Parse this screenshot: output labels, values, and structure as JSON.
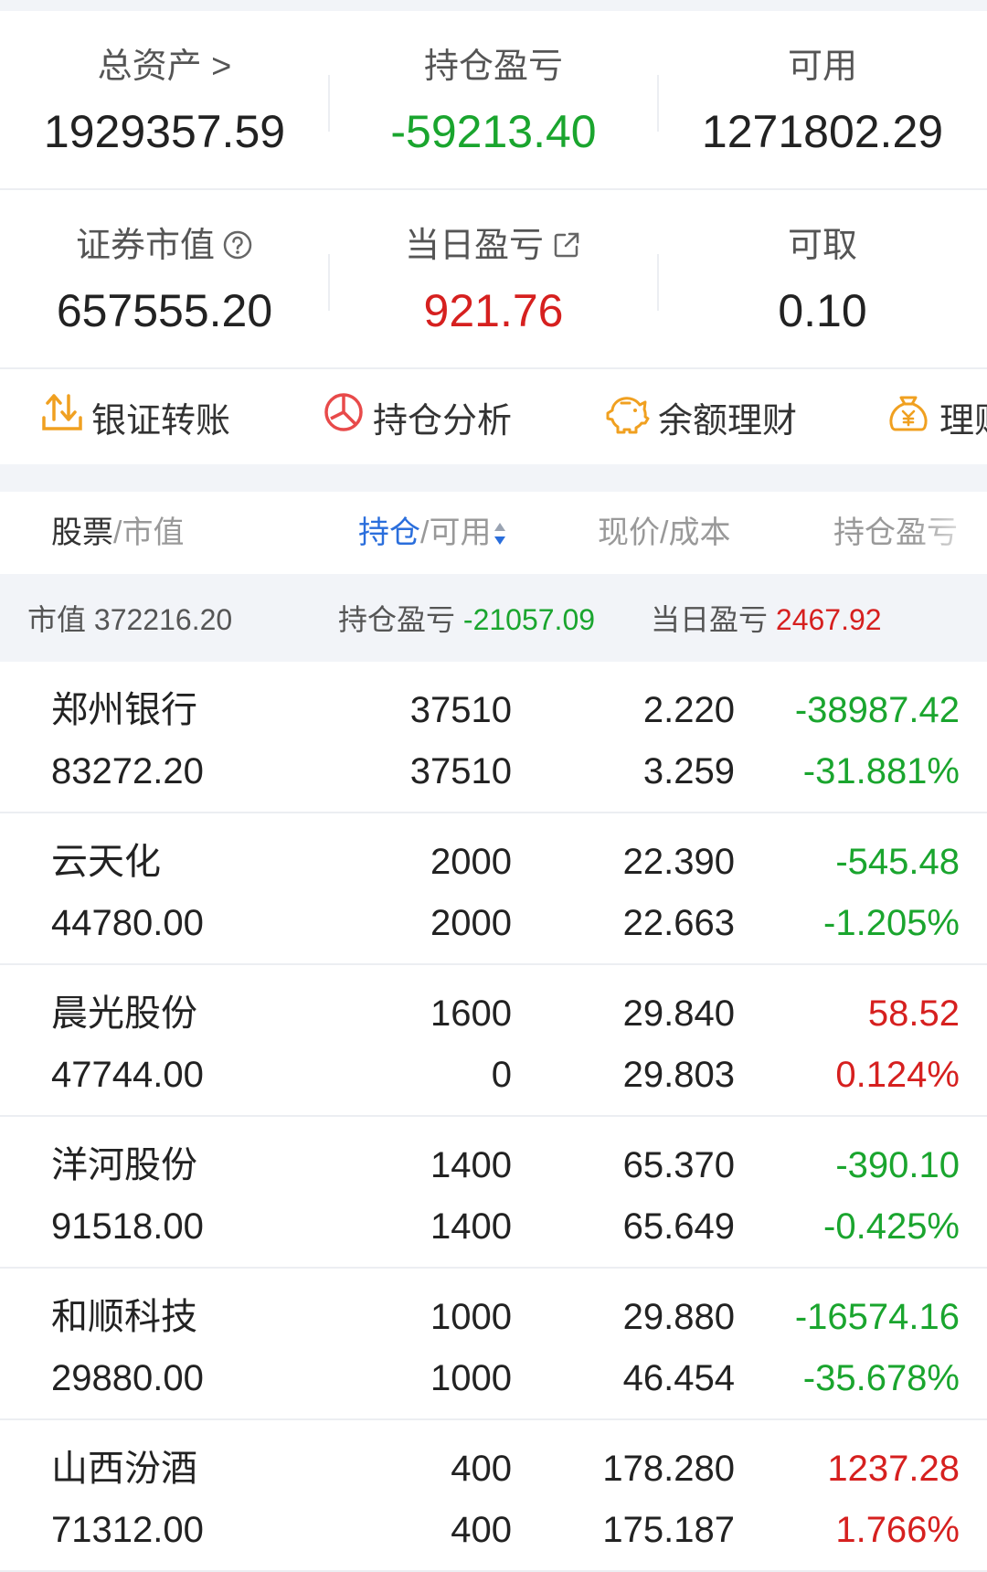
{
  "summary": {
    "total_assets_label": "总资产 >",
    "total_assets": "1929357.59",
    "holding_pl_label": "持仓盈亏",
    "holding_pl": "-59213.40",
    "available_label": "可用",
    "available": "1271802.29",
    "market_value_label": "证券市值",
    "market_value": "657555.20",
    "daily_pl_label": "当日盈亏",
    "daily_pl": "921.76",
    "withdrawable_label": "可取",
    "withdrawable": "0.10"
  },
  "actions": [
    {
      "label": "银证转账",
      "icon": "transfer-icon"
    },
    {
      "label": "持仓分析",
      "icon": "pie-chart-icon"
    },
    {
      "label": "余额理财",
      "icon": "piggy-bank-icon"
    },
    {
      "label": "理财",
      "icon": "money-bag-icon"
    }
  ],
  "table_header": {
    "col1_main": "股票",
    "col1_sub": "/市值",
    "col2_main": "持仓",
    "col2_sub": "/可用",
    "col3": "现价/成本",
    "col4": "持仓盈亏"
  },
  "group_summary": {
    "market_value_label": "市值",
    "market_value": "372216.20",
    "holding_pl_label": "持仓盈亏",
    "holding_pl": "-21057.09",
    "daily_pl_label": "当日盈亏",
    "daily_pl": "2467.92"
  },
  "stocks": [
    {
      "name": "郑州银行",
      "market_value": "83272.20",
      "position": "37510",
      "available": "37510",
      "price": "2.220",
      "cost": "3.259",
      "pl": "-38987.42",
      "pl_pct": "-31.881%",
      "trend": "down"
    },
    {
      "name": "云天化",
      "market_value": "44780.00",
      "position": "2000",
      "available": "2000",
      "price": "22.390",
      "cost": "22.663",
      "pl": "-545.48",
      "pl_pct": "-1.205%",
      "trend": "down"
    },
    {
      "name": "晨光股份",
      "market_value": "47744.00",
      "position": "1600",
      "available": "0",
      "price": "29.840",
      "cost": "29.803",
      "pl": "58.52",
      "pl_pct": "0.124%",
      "trend": "up"
    },
    {
      "name": "洋河股份",
      "market_value": "91518.00",
      "position": "1400",
      "available": "1400",
      "price": "65.370",
      "cost": "65.649",
      "pl": "-390.10",
      "pl_pct": "-0.425%",
      "trend": "down"
    },
    {
      "name": "和顺科技",
      "market_value": "29880.00",
      "position": "1000",
      "available": "1000",
      "price": "29.880",
      "cost": "46.454",
      "pl": "-16574.16",
      "pl_pct": "-35.678%",
      "trend": "down"
    },
    {
      "name": "山西汾酒",
      "market_value": "71312.00",
      "position": "400",
      "available": "400",
      "price": "178.280",
      "cost": "175.187",
      "pl": "1237.28",
      "pl_pct": "1.766%",
      "trend": "up"
    }
  ],
  "colors": {
    "up": "#d6201f",
    "down": "#1aa52e",
    "accent": "#2a6edc",
    "icon_orange": "#f0a020",
    "icon_red": "#e84a4a"
  }
}
